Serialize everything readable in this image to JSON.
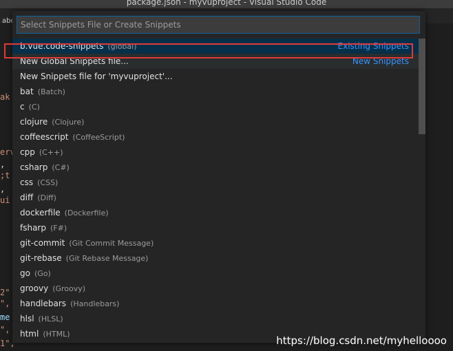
{
  "window": {
    "title": "package.json - myvuproject - Visual Studio Code"
  },
  "tabstrip": {
    "fragment": "abc"
  },
  "editor_fragments": [
    {
      "text": "ak",
      "color": "#ce9178"
    },
    {
      "text": "erv",
      "color": "#ce9178"
    },
    {
      "text": ",",
      "color": "#d4d4d4"
    },
    {
      "text": ";t",
      "color": "#ce9178"
    },
    {
      "text": ",",
      "color": "#d4d4d4"
    },
    {
      "text": "ui",
      "color": "#ce9178"
    },
    {
      "text": "2\"",
      "color": "#ce9178"
    },
    {
      "text": "\",",
      "color": "#ce9178"
    },
    {
      "text": "me",
      "color": "#9cdcfe"
    },
    {
      "text": "\",",
      "color": "#ce9178"
    },
    {
      "text": "1\",",
      "color": "#ce9178"
    }
  ],
  "picker": {
    "placeholder": "Select Snippets File or Create Snippets",
    "items": [
      {
        "name": "b.vue.code-snippets",
        "desc": "(global)",
        "detail": "Existing Snippets",
        "state": "selected"
      },
      {
        "name": "New Global Snippets file...",
        "desc": "",
        "detail": "New Snippets",
        "state": "focused"
      },
      {
        "name": "New Snippets file for 'myvuproject'...",
        "desc": "",
        "detail": "",
        "state": ""
      },
      {
        "name": "bat",
        "desc": "(Batch)",
        "detail": "",
        "state": ""
      },
      {
        "name": "c",
        "desc": "(C)",
        "detail": "",
        "state": ""
      },
      {
        "name": "clojure",
        "desc": "(Clojure)",
        "detail": "",
        "state": ""
      },
      {
        "name": "coffeescript",
        "desc": "(CoffeeScript)",
        "detail": "",
        "state": ""
      },
      {
        "name": "cpp",
        "desc": "(C++)",
        "detail": "",
        "state": ""
      },
      {
        "name": "csharp",
        "desc": "(C#)",
        "detail": "",
        "state": ""
      },
      {
        "name": "css",
        "desc": "(CSS)",
        "detail": "",
        "state": ""
      },
      {
        "name": "diff",
        "desc": "(Diff)",
        "detail": "",
        "state": ""
      },
      {
        "name": "dockerfile",
        "desc": "(Dockerfile)",
        "detail": "",
        "state": ""
      },
      {
        "name": "fsharp",
        "desc": "(F#)",
        "detail": "",
        "state": ""
      },
      {
        "name": "git-commit",
        "desc": "(Git Commit Message)",
        "detail": "",
        "state": ""
      },
      {
        "name": "git-rebase",
        "desc": "(Git Rebase Message)",
        "detail": "",
        "state": ""
      },
      {
        "name": "go",
        "desc": "(Go)",
        "detail": "",
        "state": ""
      },
      {
        "name": "groovy",
        "desc": "(Groovy)",
        "detail": "",
        "state": ""
      },
      {
        "name": "handlebars",
        "desc": "(Handlebars)",
        "detail": "",
        "state": ""
      },
      {
        "name": "hlsl",
        "desc": "(HLSL)",
        "detail": "",
        "state": ""
      },
      {
        "name": "html",
        "desc": "(HTML)",
        "detail": "",
        "state": ""
      }
    ]
  },
  "watermark": "https://blog.csdn.net/myhelloooo"
}
